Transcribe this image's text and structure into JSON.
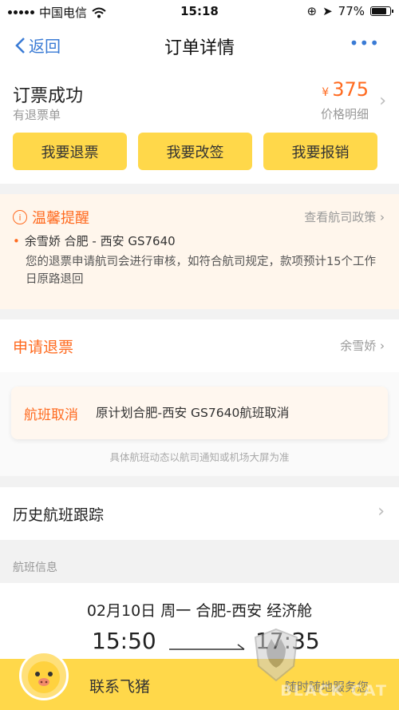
{
  "status_bar": {
    "carrier": "中国电信",
    "time": "15:18",
    "battery": "77%",
    "battery_level": 0.77
  },
  "nav": {
    "back_label": "返回",
    "title": "订单详情",
    "more": "•••"
  },
  "order": {
    "status": "订票成功",
    "sub_status": "有退票单",
    "currency": "¥",
    "price": "375",
    "price_detail": "价格明细"
  },
  "actions": [
    {
      "label": "我要退票"
    },
    {
      "label": "我要改签"
    },
    {
      "label": "我要报销"
    }
  ],
  "notice": {
    "title": "温馨提醒",
    "policy_link": "查看航司政策",
    "passenger_flight": "余雪娇 合肥 - 西安 GS7640",
    "body": "您的退票申请航司会进行审核，如符合航司规定，款项预计15个工作日原路退回"
  },
  "refund_row": {
    "label": "申请退票",
    "passenger": "余雪娇"
  },
  "cancellation": {
    "tag": "航班取消",
    "message": "原计划合肥-西安 GS7640航班取消",
    "note": "具体航班动态以航司通知或机场大屏为准"
  },
  "history": {
    "label": "历史航班跟踪"
  },
  "flight_section": {
    "title": "航班信息",
    "route": "02月10日 周一 合肥-西安 经济舱",
    "depart_time": "15:50",
    "arrive_time": "17:35"
  },
  "bottom_bar": {
    "contact": "联系飞猪",
    "service": "随时随地服务您"
  },
  "watermark": {
    "text": "BLACK CAT"
  },
  "colors": {
    "accent": "#ff6a1f",
    "button": "#ffd84a",
    "link": "#3a7bd5"
  }
}
